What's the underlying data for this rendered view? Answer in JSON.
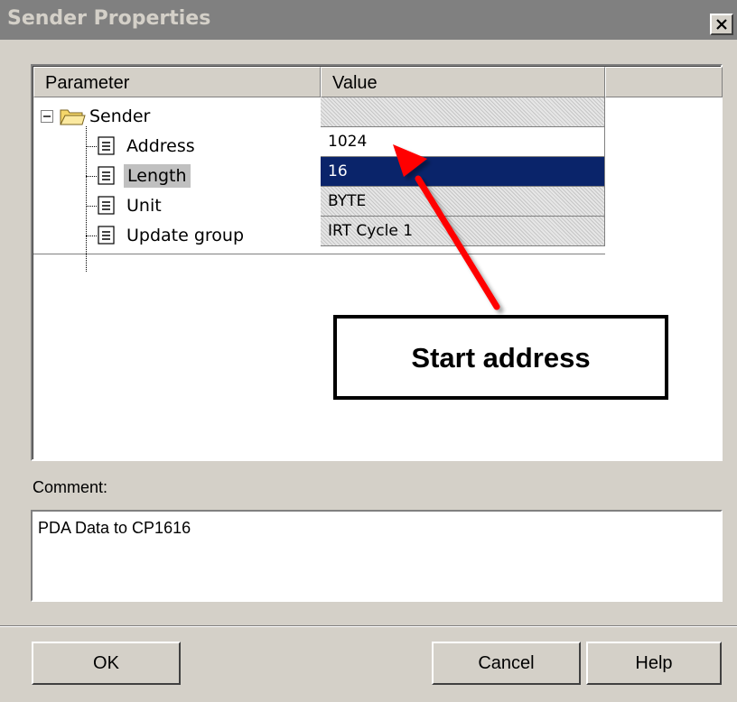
{
  "window": {
    "title": "Sender Properties",
    "close_label": "×"
  },
  "grid": {
    "columns": [
      "Parameter",
      "Value"
    ],
    "root": {
      "label": "Sender",
      "expander": "minus",
      "icon": "folder-icon"
    },
    "rows": [
      {
        "label": "Address",
        "value": "1024",
        "state": "editable"
      },
      {
        "label": "Length",
        "value": "16",
        "state": "selected"
      },
      {
        "label": "Unit",
        "value": "BYTE",
        "state": "readonly"
      },
      {
        "label": "Update group",
        "value": "IRT Cycle 1",
        "state": "readonly"
      }
    ]
  },
  "comment": {
    "label": "Comment:",
    "value": "PDA Data to CP1616"
  },
  "buttons": {
    "ok": "OK",
    "cancel": "Cancel",
    "help": "Help"
  },
  "annotation": {
    "text": "Start address",
    "arrow_color": "#ff0000"
  },
  "colors": {
    "selection": "#0a246a",
    "face": "#d4d0c8",
    "title_bar": "#808080"
  }
}
